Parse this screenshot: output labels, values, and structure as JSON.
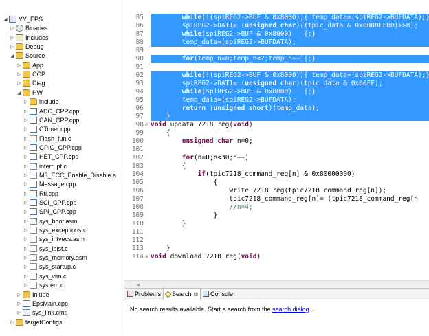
{
  "tree": [
    {
      "label": "YY_EPS",
      "icon": "project-icon",
      "cls": "project",
      "twisty": "expanded-arrow-icon",
      "depth": 0
    },
    {
      "label": "Binaries",
      "icon": "binaries-icon",
      "cls": "binaries",
      "twisty": "collapsed-arrow-icon",
      "depth": 1
    },
    {
      "label": "Includes",
      "icon": "includes-icon",
      "cls": "includes",
      "twisty": "collapsed-arrow-icon",
      "depth": 1
    },
    {
      "label": "Debug",
      "icon": "folder-icon",
      "cls": "folder",
      "twisty": "collapsed-arrow-icon",
      "depth": 1
    },
    {
      "label": "Source",
      "icon": "folder-icon",
      "cls": "folder",
      "twisty": "expanded-arrow-icon",
      "depth": 1
    },
    {
      "label": "App",
      "icon": "folder-icon",
      "cls": "folder",
      "twisty": "collapsed-arrow-icon",
      "depth": 2
    },
    {
      "label": "CCP",
      "icon": "folder-icon",
      "cls": "folder",
      "twisty": "collapsed-arrow-icon",
      "depth": 2
    },
    {
      "label": "Diag",
      "icon": "folder-icon",
      "cls": "folder",
      "twisty": "collapsed-arrow-icon",
      "depth": 2
    },
    {
      "label": "HW",
      "icon": "folder-icon",
      "cls": "folder",
      "twisty": "expanded-arrow-icon",
      "depth": 2
    },
    {
      "label": "include",
      "icon": "folder-icon",
      "cls": "folder",
      "twisty": "collapsed-arrow-icon",
      "depth": 3
    },
    {
      "label": "ADC_CPP.cpp",
      "icon": "cpp-file-icon",
      "cls": "file-cpp",
      "twisty": "collapsed-arrow-icon",
      "depth": 3
    },
    {
      "label": "CAN_CPP.cpp",
      "icon": "cpp-file-icon",
      "cls": "file-cpp",
      "twisty": "collapsed-arrow-icon",
      "depth": 3
    },
    {
      "label": "CTimer.cpp",
      "icon": "cpp-file-icon",
      "cls": "file-cpp",
      "twisty": "collapsed-arrow-icon",
      "depth": 3
    },
    {
      "label": "Flash_fun.c",
      "icon": "c-file-icon",
      "cls": "file-c",
      "twisty": "collapsed-arrow-icon",
      "depth": 3
    },
    {
      "label": "GPIO_CPP.cpp",
      "icon": "cpp-file-icon",
      "cls": "file-cpp",
      "twisty": "collapsed-arrow-icon",
      "depth": 3
    },
    {
      "label": "HET_CPP.cpp",
      "icon": "cpp-file-icon",
      "cls": "file-cpp",
      "twisty": "collapsed-arrow-icon",
      "depth": 3
    },
    {
      "label": "interrupt.c",
      "icon": "c-file-icon",
      "cls": "file-c",
      "twisty": "collapsed-arrow-icon",
      "depth": 3
    },
    {
      "label": "M3_ECC_Enable_Disable.a",
      "icon": "c-file-icon",
      "cls": "file-c",
      "twisty": "collapsed-arrow-icon",
      "depth": 3
    },
    {
      "label": "Message.cpp",
      "icon": "cpp-file-icon",
      "cls": "file-cpp",
      "twisty": "collapsed-arrow-icon",
      "depth": 3
    },
    {
      "label": "Rti.cpp",
      "icon": "cpp-file-icon",
      "cls": "file-cpp",
      "twisty": "collapsed-arrow-icon",
      "depth": 3
    },
    {
      "label": "SCI_CPP.cpp",
      "icon": "cpp-file-icon",
      "cls": "file-cpp",
      "twisty": "collapsed-arrow-icon",
      "depth": 3
    },
    {
      "label": "SPI_CPP.cpp",
      "icon": "cpp-file-icon",
      "cls": "file-cpp",
      "twisty": "collapsed-arrow-icon",
      "depth": 3
    },
    {
      "label": "sys_boot.asm",
      "icon": "asm-file-icon",
      "cls": "file-asm",
      "twisty": "collapsed-arrow-icon",
      "depth": 3
    },
    {
      "label": "sys_exceptions.c",
      "icon": "c-file-icon",
      "cls": "file-c",
      "twisty": "collapsed-arrow-icon",
      "depth": 3
    },
    {
      "label": "sys_intvecs.asm",
      "icon": "asm-file-icon",
      "cls": "file-asm",
      "twisty": "collapsed-arrow-icon",
      "depth": 3
    },
    {
      "label": "sys_lbist.c",
      "icon": "c-file-icon",
      "cls": "file-c",
      "twisty": "collapsed-arrow-icon",
      "depth": 3
    },
    {
      "label": "sys_memory.asm",
      "icon": "asm-file-icon",
      "cls": "file-asm",
      "twisty": "collapsed-arrow-icon",
      "depth": 3
    },
    {
      "label": "sys_startup.c",
      "icon": "c-file-icon",
      "cls": "file-c",
      "twisty": "collapsed-arrow-icon",
      "depth": 3
    },
    {
      "label": "sys_vim.c",
      "icon": "c-file-icon",
      "cls": "file-c",
      "twisty": "collapsed-arrow-icon",
      "depth": 3
    },
    {
      "label": "system.c",
      "icon": "c-file-icon",
      "cls": "file-c",
      "twisty": "collapsed-arrow-icon",
      "depth": 3
    },
    {
      "label": "Inlude",
      "icon": "folder-icon",
      "cls": "folder",
      "twisty": "collapsed-arrow-icon",
      "depth": 2
    },
    {
      "label": "EpsMain.cpp",
      "icon": "cpp-file-icon",
      "cls": "file-cpp",
      "twisty": "collapsed-arrow-icon",
      "depth": 2
    },
    {
      "label": "sys_link.cmd",
      "icon": "cmd-file-icon",
      "cls": "file-cmd",
      "twisty": "collapsed-arrow-icon",
      "depth": 2
    },
    {
      "label": "targetConfigs",
      "icon": "folder-icon",
      "cls": "folder",
      "twisty": "collapsed-arrow-icon",
      "depth": 1
    }
  ],
  "twisty_glyphs": {
    "expanded": "◢",
    "collapsed": "▷"
  },
  "editor": {
    "lines": [
      {
        "n": "85",
        "sel": true,
        "parts": [
          [
            "",
            "        "
          ],
          [
            "kw",
            "while"
          ],
          [
            "",
            "(!(spiREG2->BUF & 0x8000)){ temp_data=(spiREG2->BUFDATA);}"
          ]
        ]
      },
      {
        "n": "86",
        "sel": true,
        "parts": [
          [
            "",
            "        spiREG2->DAT1= ("
          ],
          [
            "kw",
            "unsigned char"
          ],
          [
            "",
            ")((tpic_data & 0x0000FF00)>>8);"
          ]
        ]
      },
      {
        "n": "87",
        "sel": true,
        "parts": [
          [
            "",
            "        "
          ],
          [
            "kw",
            "while"
          ],
          [
            "",
            "(spiREG2->BUF & 0x8000)   {;}"
          ]
        ]
      },
      {
        "n": "88",
        "sel": true,
        "parts": [
          [
            "",
            "        temp_data=(spiREG2->BUFDATA);"
          ]
        ]
      },
      {
        "n": "89",
        "sel": true,
        "parts": [
          [
            "",
            ""
          ]
        ]
      },
      {
        "n": "90",
        "sel": true,
        "parts": [
          [
            "",
            "        "
          ],
          [
            "kw",
            "for"
          ],
          [
            "",
            "(temp_n=0;temp_n<2;temp_n++){;}"
          ]
        ]
      },
      {
        "n": "91",
        "sel": true,
        "parts": [
          [
            "",
            ""
          ]
        ]
      },
      {
        "n": "92",
        "sel": true,
        "parts": [
          [
            "",
            "        "
          ],
          [
            "kw",
            "while"
          ],
          [
            "",
            "(!(spiREG2->BUF & 0x8000)){ temp_data=(spiREG2->BUFDATA);}"
          ]
        ]
      },
      {
        "n": "93",
        "sel": true,
        "parts": [
          [
            "",
            "        spiREG2->DAT1= ("
          ],
          [
            "kw",
            "unsigned char"
          ],
          [
            "",
            ")(tpic_data & 0x00FF);"
          ]
        ]
      },
      {
        "n": "94",
        "sel": true,
        "parts": [
          [
            "",
            "        "
          ],
          [
            "kw",
            "while"
          ],
          [
            "",
            "(spiREG2->BUF & 0x8000)   {;}"
          ]
        ]
      },
      {
        "n": "95",
        "sel": true,
        "parts": [
          [
            "",
            "        temp_data=(spiREG2->BUFDATA);"
          ]
        ]
      },
      {
        "n": "96",
        "sel": true,
        "parts": [
          [
            "",
            "        "
          ],
          [
            "kw",
            "return"
          ],
          [
            "",
            " ("
          ],
          [
            "kw",
            "unsigned short"
          ],
          [
            "",
            ")(temp_data);"
          ]
        ]
      },
      {
        "n": "97",
        "sel": true,
        "parts": [
          [
            "",
            "    }"
          ]
        ]
      },
      {
        "n": "98",
        "sel": false,
        "fold": "⊖",
        "parts": [
          [
            "kw",
            "void"
          ],
          [
            "",
            " updata_7218_reg("
          ],
          [
            "kw",
            "void"
          ],
          [
            "",
            ")"
          ]
        ]
      },
      {
        "n": "99",
        "sel": false,
        "parts": [
          [
            "",
            "    {"
          ]
        ]
      },
      {
        "n": "100",
        "sel": false,
        "parts": [
          [
            "",
            "        "
          ],
          [
            "kw",
            "unsigned char"
          ],
          [
            "",
            " n=0;"
          ]
        ]
      },
      {
        "n": "101",
        "sel": false,
        "parts": [
          [
            "",
            ""
          ]
        ]
      },
      {
        "n": "102",
        "sel": false,
        "parts": [
          [
            "",
            "        "
          ],
          [
            "kw",
            "for"
          ],
          [
            "",
            "(n=0;n<30;n++)"
          ]
        ]
      },
      {
        "n": "103",
        "sel": false,
        "parts": [
          [
            "",
            "        {"
          ]
        ]
      },
      {
        "n": "104",
        "sel": false,
        "parts": [
          [
            "",
            "            "
          ],
          [
            "kw",
            "if"
          ],
          [
            "",
            "(tpic7218_command_reg[n] & 0x80000000)"
          ]
        ]
      },
      {
        "n": "105",
        "sel": false,
        "parts": [
          [
            "",
            "                {"
          ]
        ]
      },
      {
        "n": "106",
        "sel": false,
        "parts": [
          [
            "",
            "                    write_7218_reg(tpic7218_command_reg[n]);"
          ]
        ]
      },
      {
        "n": "107",
        "sel": false,
        "parts": [
          [
            "",
            "                    tpic7218_command_reg[n]= (tpic7218_command_reg[n"
          ]
        ]
      },
      {
        "n": "108",
        "sel": false,
        "parts": [
          [
            "",
            "                    "
          ],
          [
            "cm",
            "//n=4;"
          ]
        ]
      },
      {
        "n": "109",
        "sel": false,
        "parts": [
          [
            "",
            "                }"
          ]
        ]
      },
      {
        "n": "110",
        "sel": false,
        "parts": [
          [
            "",
            "        }"
          ]
        ]
      },
      {
        "n": "111",
        "sel": false,
        "parts": [
          [
            "",
            ""
          ]
        ]
      },
      {
        "n": "112",
        "sel": false,
        "parts": [
          [
            "",
            ""
          ]
        ]
      },
      {
        "n": "113",
        "sel": false,
        "parts": [
          [
            "",
            "    }"
          ]
        ]
      },
      {
        "n": "114",
        "sel": false,
        "fold": "⊕",
        "parts": [
          [
            "kw",
            "void"
          ],
          [
            "",
            " download_7218_reg("
          ],
          [
            "kw",
            "void"
          ],
          [
            "",
            ")"
          ]
        ]
      }
    ]
  },
  "scrollbar": {
    "left_arrow": "◂"
  },
  "panel": {
    "tabs": [
      {
        "label": "Problems",
        "icon": "problems-icon",
        "cls": "problems",
        "active": false
      },
      {
        "label": "Search",
        "icon": "search-icon",
        "cls": "search",
        "active": true,
        "close": "⊠"
      },
      {
        "label": "Console",
        "icon": "console-icon",
        "cls": "console",
        "active": false
      }
    ],
    "message_prefix": "No search results available. Start a search from the ",
    "message_link": "search dialog",
    "message_suffix": "..."
  }
}
